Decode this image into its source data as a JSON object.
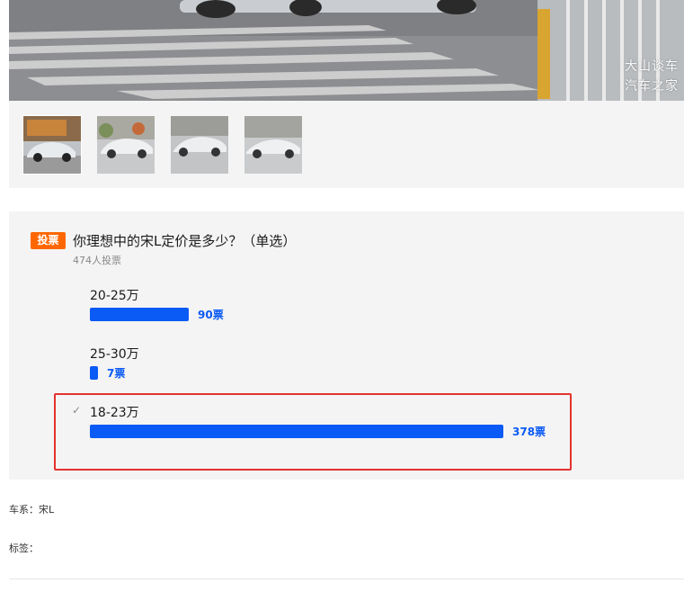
{
  "gallery": {
    "watermark_line1": "大山谈车",
    "watermark_line2": "汽车之家",
    "thumbnails": [
      "thumb-1",
      "thumb-2",
      "thumb-3",
      "thumb-4"
    ]
  },
  "poll": {
    "badge": "投票",
    "question": "你理想中的宋L定价是多少？（单选）",
    "participants": "474人投票",
    "options": [
      {
        "label": "20-25万",
        "votes": 90,
        "votes_text": "90票",
        "selected": false
      },
      {
        "label": "25-30万",
        "votes": 7,
        "votes_text": "7票",
        "selected": false
      },
      {
        "label": "18-23万",
        "votes": 378,
        "votes_text": "378票",
        "selected": true
      }
    ],
    "selected_mark": "✓",
    "bar_color": "#0a5af5",
    "highlight_color": "#e5322d"
  },
  "meta": {
    "series_label": "车系：",
    "series_value": "宋L",
    "tags_label": "标签："
  }
}
